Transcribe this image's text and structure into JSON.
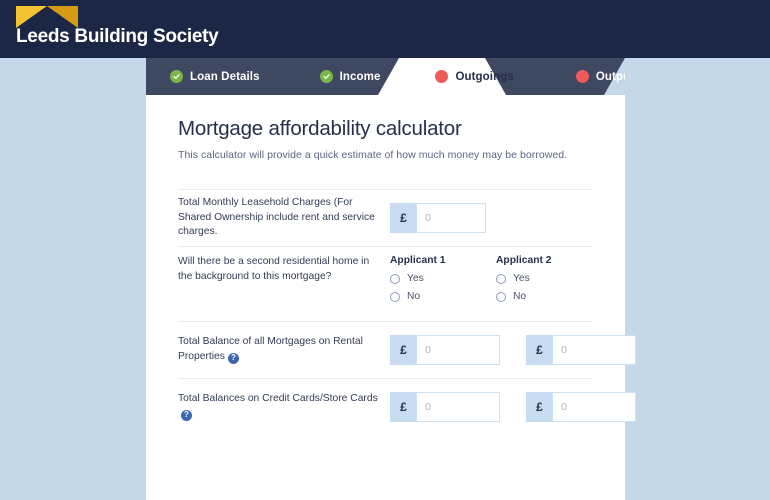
{
  "brand": {
    "name": "Leeds Building Society",
    "logo_icon": "roof-chevron-logo",
    "header_bg": "#1b2744",
    "logo_color_left": "#f2c230",
    "logo_color_right": "#d79a14"
  },
  "colors": {
    "page_bg": "#c5d8ea",
    "nav_bg": "#3e4860",
    "nav_active_bg": "#ffffff",
    "status_complete": "#7ab648",
    "status_incomplete": "#ef5a5a",
    "accent_prefix": "#c7dcf0",
    "help_icon": "#3d67b0",
    "text_dark": "#27304a"
  },
  "nav": {
    "items": [
      {
        "label": "Loan Details",
        "status": "complete",
        "active": false,
        "dot_icon": "check-circle-icon"
      },
      {
        "label": "Income",
        "status": "complete",
        "active": false,
        "dot_icon": "check-circle-icon"
      },
      {
        "label": "Outgoings",
        "status": "incomplete",
        "active": true,
        "dot_icon": "dot-circle-icon"
      },
      {
        "label": "Output",
        "status": "incomplete",
        "active": false,
        "dot_icon": "dot-circle-icon"
      }
    ]
  },
  "main": {
    "title": "Mortgage affordability calculator",
    "subtitle": "This calculator will provide a quick estimate of how much money may be borrowed.",
    "rows": [
      {
        "id": "leasehold-charges",
        "label": "Total Monthly Leasehold Charges (For Shared Ownership include rent and service charges.",
        "help": false,
        "type": "money-single",
        "fields": [
          {
            "prefix": "£",
            "value": "",
            "placeholder": "0"
          }
        ]
      },
      {
        "id": "second-residential-home",
        "label": "Will there be a second residential home in the background to this mortgage?",
        "help": false,
        "type": "radio-pair",
        "columns": [
          {
            "heading": "Applicant 1",
            "options": [
              {
                "label": "Yes",
                "selected": false
              },
              {
                "label": "No",
                "selected": false
              }
            ]
          },
          {
            "heading": "Applicant 2",
            "options": [
              {
                "label": "Yes",
                "selected": false
              },
              {
                "label": "No",
                "selected": false
              }
            ]
          }
        ]
      },
      {
        "id": "rental-mortgage-balance",
        "label": "Total Balance of all Mortgages on Rental Properties",
        "help": true,
        "help_glyph": "?",
        "type": "money-pair",
        "fields": [
          {
            "prefix": "£",
            "value": "",
            "placeholder": "0"
          },
          {
            "prefix": "£",
            "value": "",
            "placeholder": "0"
          }
        ]
      },
      {
        "id": "credit-store-card-balance",
        "label": "Total Balances on Credit Cards/Store Cards",
        "help": true,
        "help_glyph": "?",
        "type": "money-pair",
        "fields": [
          {
            "prefix": "£",
            "value": "",
            "placeholder": "0"
          },
          {
            "prefix": "£",
            "value": "",
            "placeholder": "0"
          }
        ]
      }
    ]
  }
}
